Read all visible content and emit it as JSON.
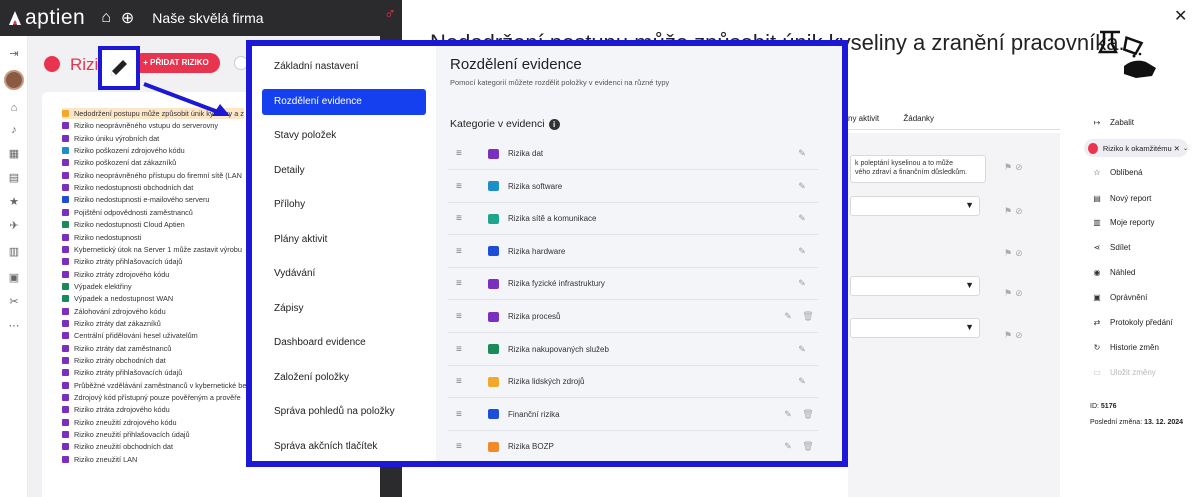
{
  "app": {
    "logo": "aptien",
    "company": "Naše skvělá firma"
  },
  "list": {
    "title": "Rizika",
    "add_button": "+ PŘIDAT RIZIKO",
    "items": [
      "Nedodržení postupu může způsobit únik kyseliny a z",
      "Riziko neoprávněného vstupu do serverovny",
      "Riziko úniku výrobních dat",
      "Riziko poškození zdrojového kódu",
      "Riziko poškození dat zákazníků",
      "Riziko neoprávněného přístupu do firemní sítě (LAN",
      "Riziko nedostupnosti obchodních dat",
      "Riziko nedostupnosti e-mailového serveru",
      "Pojištění odpovědnosti zaměstnanců",
      "Riziko nedostupnosti Cloud Aptien",
      "Riziko nedostupnosti",
      "Kybernetický útok na Server 1 může zastavit výrobu",
      "Riziko ztráty přihlašovacích údajů",
      "Riziko ztráty zdrojového kódu",
      "Výpadek elektřiny",
      "Výpadek a nedostupnost WAN",
      "Zálohování zdrojového kódu",
      "Riziko ztráty dat zákazníků",
      "Centrální přidělování hesel uživatelům",
      "Riziko ztráty dat zaměstnanců",
      "Riziko ztráty obchodních dat",
      "Riziko ztráty přihlašovacích údajů",
      "Průběžné vzdělávání zaměstnanců v kybernetické be",
      "Zdrojový kód přístupný pouze pověřeným a prověře",
      "Riziko ztráta zdrojového kódu",
      "Riziko zneužití zdrojového kódu",
      "Riziko zneužití přihlašovacích údajů",
      "Riziko zneužití obchodních dat",
      "Riziko zneužití LAN"
    ]
  },
  "detail": {
    "title": "Nedodržení postupu může způsobit únik kyseliny a zranění pracovníka.",
    "tabs": [
      "ny aktivit",
      "Žádanky"
    ],
    "text_snippet": "k poleptání kyselinou a to může\nvého zdraví a finančním důsledkům."
  },
  "sidebar_right": {
    "items": [
      {
        "icon": "collapse-icon",
        "label": "Zabalit"
      },
      {
        "icon": "star-icon",
        "label": "Oblíbená"
      },
      {
        "icon": "report-icon",
        "label": "Nový report"
      },
      {
        "icon": "reports-icon",
        "label": "Moje reporty"
      },
      {
        "icon": "share-icon",
        "label": "Sdílet"
      },
      {
        "icon": "eye-icon",
        "label": "Náhled"
      },
      {
        "icon": "permissions-icon",
        "label": "Oprávnění"
      },
      {
        "icon": "handover-icon",
        "label": "Protokoly předání"
      },
      {
        "icon": "history-icon",
        "label": "Historie změn"
      },
      {
        "icon": "save-icon",
        "label": "Uložit změny"
      }
    ],
    "badge": "Riziko k okamžitému",
    "id_label": "ID:",
    "id_value": "5176",
    "last_change_label": "Poslední změna:",
    "last_change_value": "13. 12. 2024"
  },
  "modal": {
    "nav": [
      "Základní nastavení",
      "Rozdělení evidence",
      "Stavy položek",
      "Detaily",
      "Přílohy",
      "Plány aktivit",
      "Vydávání",
      "Zápisy",
      "Dashboard evidence",
      "Založení položky",
      "Správa pohledů na položky",
      "Správa akčních tlačítek"
    ],
    "active_nav": "Rozdělení evidence",
    "title": "Rozdělení evidence",
    "subtitle": "Pomocí kategorií můžete rozdělit položky v evidenci na různé typy",
    "section_title": "Kategorie v evidenci",
    "categories": [
      {
        "label": "Rizika dat",
        "icon": "floppy-icon",
        "color": "#7b2fbf",
        "deletable": false
      },
      {
        "label": "Rizika software",
        "icon": "monitor-icon",
        "color": "#1c8fc9",
        "deletable": false
      },
      {
        "label": "Rizika sítě a komunikace",
        "icon": "network-icon",
        "color": "#1fa58c",
        "deletable": false
      },
      {
        "label": "Rizika hardware",
        "icon": "hardware-icon",
        "color": "#1d4ed8",
        "deletable": false
      },
      {
        "label": "Rizika fyzické infrastruktury",
        "icon": "door-icon",
        "color": "#7b2fbf",
        "deletable": false
      },
      {
        "label": "Rizika procesů",
        "icon": "process-icon",
        "color": "#7b2fbf",
        "deletable": true
      },
      {
        "label": "Rizika nakupovaných služeb",
        "icon": "bag-icon",
        "color": "#1b8a5a",
        "deletable": false
      },
      {
        "label": "Rizika lidských zdrojů",
        "icon": "person-icon",
        "color": "#f0a92a",
        "deletable": false
      },
      {
        "label": "Finanční rizika",
        "icon": "money-icon",
        "color": "#1d4ed8",
        "deletable": true
      },
      {
        "label": "Rizika BOZP",
        "icon": "worker-icon",
        "color": "#f08a2a",
        "deletable": true
      }
    ]
  },
  "colors": {
    "accent": "#e8344e",
    "highlight_border": "#1d17d6",
    "active_nav": "#1540ef"
  }
}
